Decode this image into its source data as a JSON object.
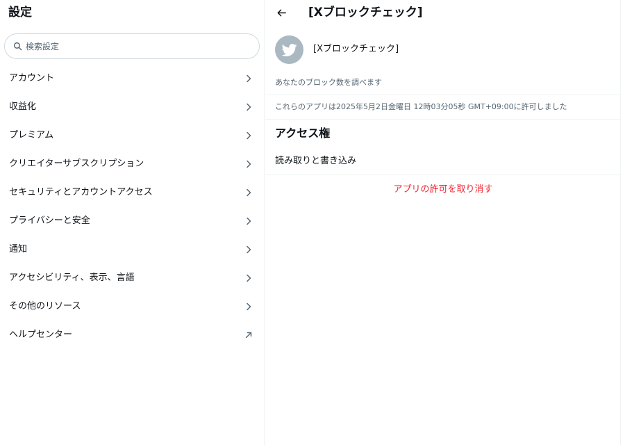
{
  "settings": {
    "title": "設定",
    "search": {
      "placeholder": "検索設定",
      "value": "",
      "icon": "search-icon"
    },
    "items": [
      {
        "label": "アカウント",
        "icon": "chevron-right-icon"
      },
      {
        "label": "収益化",
        "icon": "chevron-right-icon"
      },
      {
        "label": "プレミアム",
        "icon": "chevron-right-icon"
      },
      {
        "label": "クリエイターサブスクリプション",
        "icon": "chevron-right-icon"
      },
      {
        "label": "セキュリティとアカウントアクセス",
        "icon": "chevron-right-icon"
      },
      {
        "label": "プライバシーと安全",
        "icon": "chevron-right-icon"
      },
      {
        "label": "通知",
        "icon": "chevron-right-icon"
      },
      {
        "label": "アクセシビリティ、表示、言語",
        "icon": "chevron-right-icon"
      },
      {
        "label": "その他のリソース",
        "icon": "chevron-right-icon"
      },
      {
        "label": "ヘルプセンター",
        "icon": "external-link-icon"
      }
    ]
  },
  "detail": {
    "back_icon": "arrow-left-icon",
    "title": "[Xブロックチェック]",
    "app": {
      "name": "[Xブロックチェック]",
      "avatar_icon": "bird-icon",
      "avatar_color": "#aab8c2",
      "description": "あなたのブロック数を調べます"
    },
    "grant_text": "これらのアプリは2025年5月2日金曜日 12時03分05秒 GMT+09:00に許可しました",
    "access": {
      "title": "アクセス権",
      "permission": "読み取りと書き込み"
    },
    "revoke_label": "アプリの許可を取り消す",
    "revoke_color": "#f4212e"
  }
}
